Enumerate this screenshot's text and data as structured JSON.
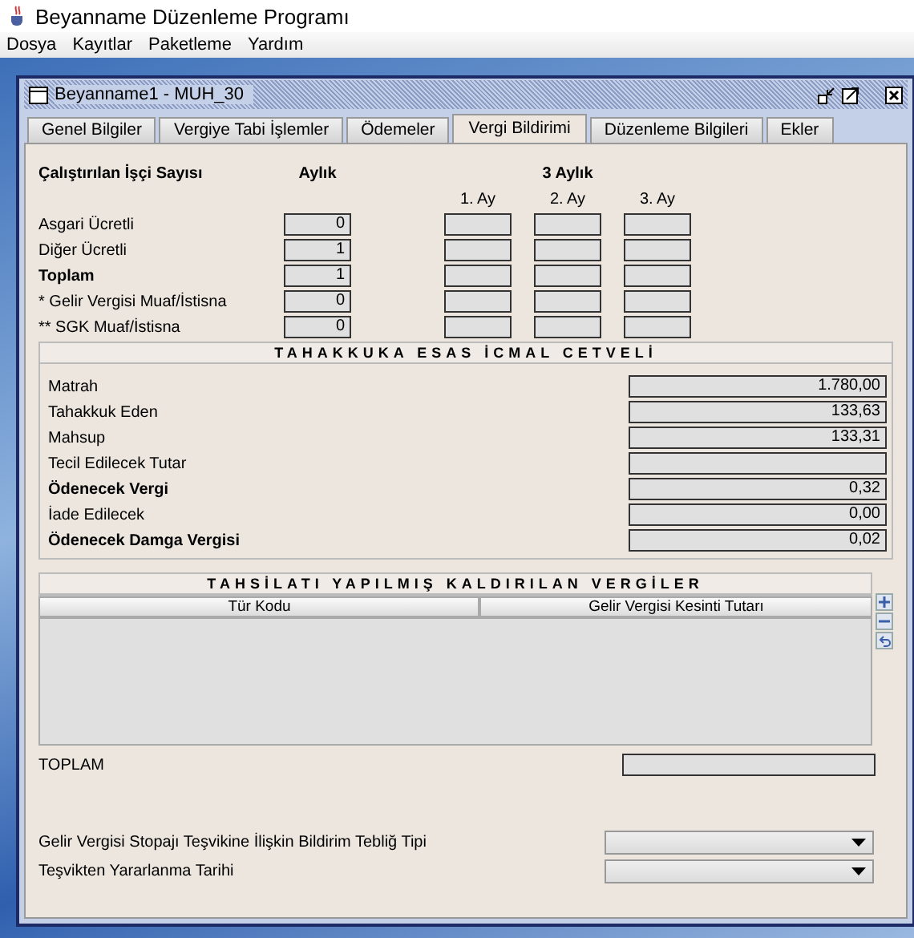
{
  "app": {
    "title": "Beyanname Düzenleme Programı",
    "menu": [
      "Dosya",
      "Kayıtlar",
      "Paketleme",
      "Yardım"
    ]
  },
  "window": {
    "title": "Beyanname1 - MUH_30"
  },
  "tabs": [
    {
      "label": "Genel Bilgiler",
      "selected": false
    },
    {
      "label": "Vergiye Tabi İşlemler",
      "selected": false
    },
    {
      "label": "Ödemeler",
      "selected": false
    },
    {
      "label": "Vergi Bildirimi",
      "selected": true
    },
    {
      "label": "Düzenleme Bilgileri",
      "selected": false
    },
    {
      "label": "Ekler",
      "selected": false
    }
  ],
  "workers": {
    "title": "Çalıştırılan İşçi Sayısı",
    "monthly_heading": "Aylık",
    "quarterly_heading": "3 Aylık",
    "month_headings": [
      "1. Ay",
      "2. Ay",
      "3. Ay"
    ],
    "rows": [
      {
        "label": "Asgari Ücretli",
        "bold": false,
        "monthly": "0"
      },
      {
        "label": "Diğer Ücretli",
        "bold": false,
        "monthly": "1"
      },
      {
        "label": "Toplam",
        "bold": true,
        "monthly": "1"
      },
      {
        "label": "* Gelir Vergisi Muaf/İstisna",
        "bold": false,
        "monthly": "0"
      },
      {
        "label": "** SGK Muaf/İstisna",
        "bold": false,
        "monthly": "0"
      }
    ]
  },
  "icmal": {
    "title": "TAHAKKUKA ESAS İCMAL CETVELİ",
    "rows": [
      {
        "label": "Matrah",
        "bold": false,
        "value": "1.780,00"
      },
      {
        "label": "Tahakkuk Eden",
        "bold": false,
        "value": "133,63"
      },
      {
        "label": "Mahsup",
        "bold": false,
        "value": "133,31"
      },
      {
        "label": "Tecil Edilecek Tutar",
        "bold": false
      },
      {
        "label": "Ödenecek Vergi",
        "bold": true,
        "value": "0,32"
      },
      {
        "label": "İade Edilecek",
        "bold": false,
        "value": "0,00"
      },
      {
        "label": "Ödenecek Damga Vergisi",
        "bold": true,
        "value": "0,02"
      }
    ]
  },
  "tahsilat": {
    "title": "TAHSİLATI YAPILMIŞ KALDIRILAN VERGİLER",
    "columns": [
      "Tür Kodu",
      "Gelir Vergisi Kesinti Tutarı"
    ],
    "total_label": "TOPLAM"
  },
  "selects": [
    {
      "label": "Gelir Vergisi Stopajı Teşvikine İlişkin Bildirim Tebliğ Tipi"
    },
    {
      "label": "Teşvikten Yararlanma Tarihi"
    }
  ]
}
